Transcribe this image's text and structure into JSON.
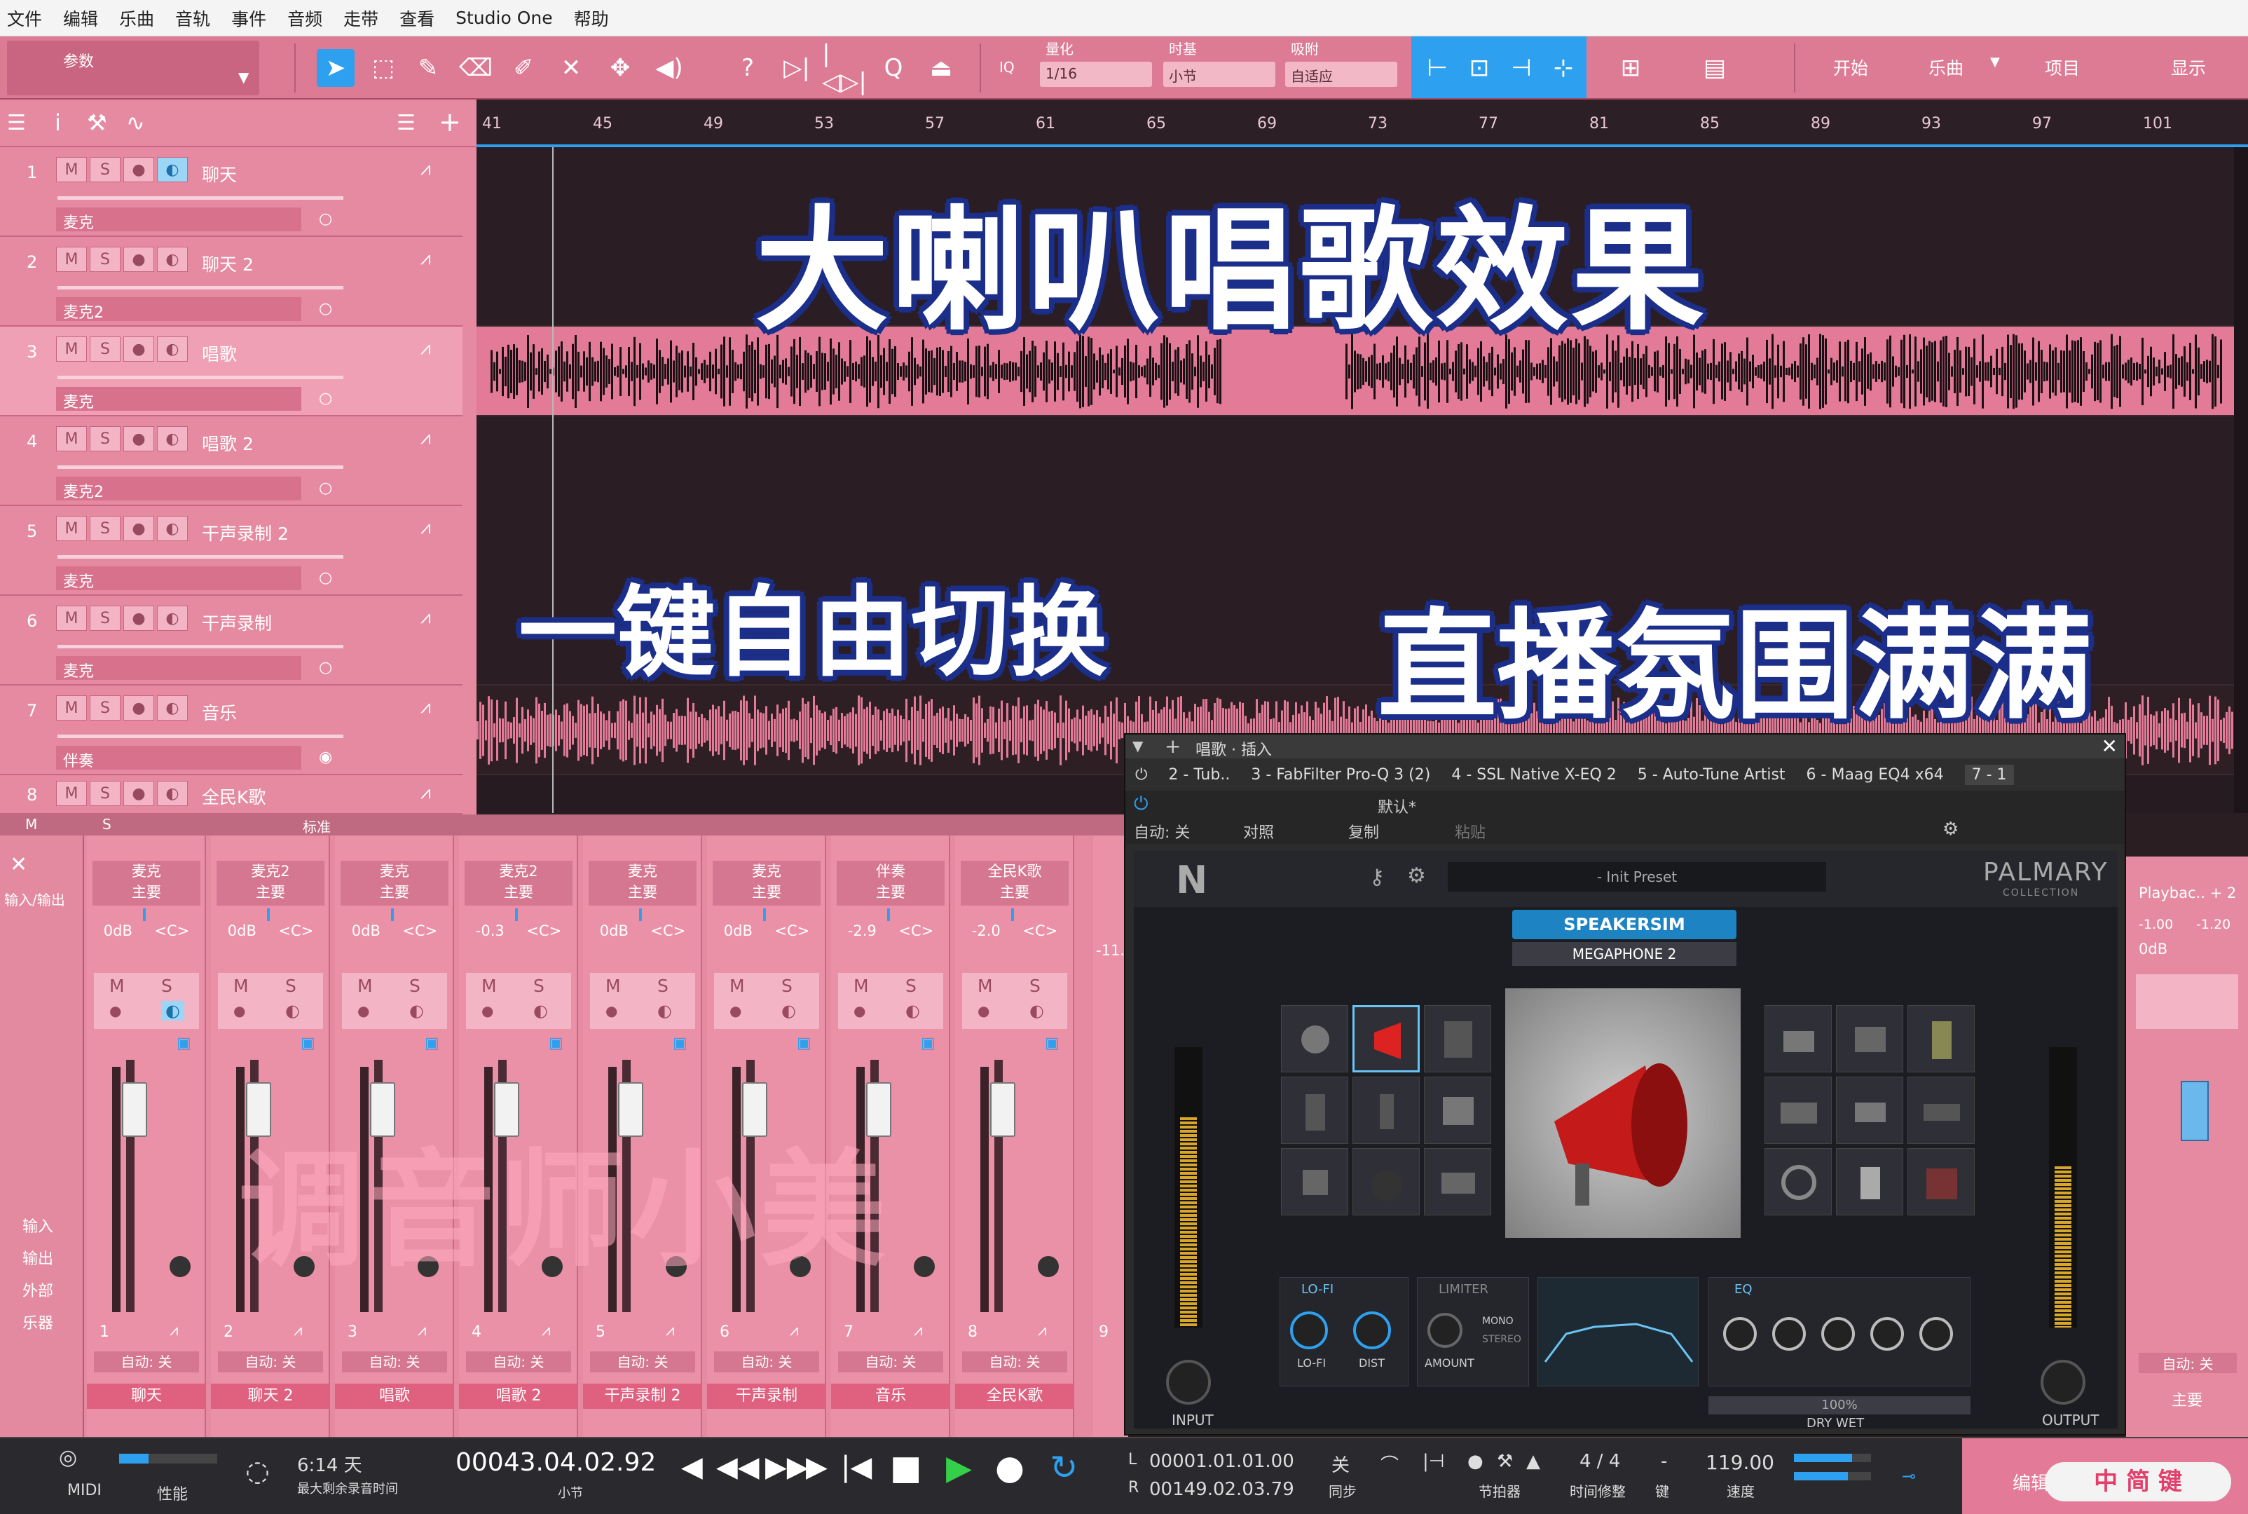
{
  "menu": [
    "文件",
    "编辑",
    "乐曲",
    "音轨",
    "事件",
    "音频",
    "走带",
    "查看",
    "Studio One",
    "帮助"
  ],
  "toolbar": {
    "params_label": "参数",
    "quantize_label": "量化",
    "quantize_value": "1/16",
    "timebase_label": "时基",
    "timebase_value": "小节",
    "snap_label": "吸附",
    "snap_value": "自适应",
    "iq_label": "IQ",
    "right_buttons": [
      "开始",
      "乐曲",
      "项目",
      "显示"
    ]
  },
  "ruler": [
    "41",
    "45",
    "49",
    "53",
    "57",
    "61",
    "65",
    "69",
    "73",
    "77",
    "81",
    "85",
    "89",
    "93",
    "97",
    "101"
  ],
  "tracks": [
    {
      "num": "1",
      "name": "聊天",
      "input": "麦克",
      "monitor": true
    },
    {
      "num": "2",
      "name": "聊天 2",
      "input": "麦克2",
      "monitor": false
    },
    {
      "num": "3",
      "name": "唱歌",
      "input": "麦克",
      "monitor": false
    },
    {
      "num": "4",
      "name": "唱歌 2",
      "input": "麦克2",
      "monitor": false
    },
    {
      "num": "5",
      "name": "干声录制 2",
      "input": "麦克",
      "monitor": false
    },
    {
      "num": "6",
      "name": "干声录制",
      "input": "麦克",
      "monitor": false
    },
    {
      "num": "7",
      "name": "音乐",
      "input": "伴奏",
      "monitor": false
    },
    {
      "num": "8",
      "name": "全民K歌",
      "input": "",
      "monitor": false
    }
  ],
  "track_buttons": {
    "m": "M",
    "s": "S"
  },
  "overlay": {
    "title": "大喇叭唱歌效果",
    "left_caption": "一键自由切换",
    "right_caption": "直播氛围满满",
    "watermark": "调音师小美"
  },
  "mixer": {
    "toolbar_label": "标准",
    "left_labels": [
      "输入",
      "输出",
      "外部",
      "乐器"
    ],
    "io_label": "输入/输出",
    "channels": [
      {
        "src": "麦克",
        "bus": "主要",
        "vol": "0dB",
        "pan": "<C>",
        "num": "1",
        "auto": "自动: 关",
        "name": "聊天",
        "monitor": true
      },
      {
        "src": "麦克2",
        "bus": "主要",
        "vol": "0dB",
        "pan": "<C>",
        "num": "2",
        "auto": "自动: 关",
        "name": "聊天 2",
        "monitor": false
      },
      {
        "src": "麦克",
        "bus": "主要",
        "vol": "0dB",
        "pan": "<C>",
        "num": "3",
        "auto": "自动: 关",
        "name": "唱歌",
        "monitor": false
      },
      {
        "src": "麦克2",
        "bus": "主要",
        "vol": "-0.3",
        "pan": "<C>",
        "num": "4",
        "auto": "自动: 关",
        "name": "唱歌 2",
        "monitor": false
      },
      {
        "src": "麦克",
        "bus": "主要",
        "vol": "0dB",
        "pan": "<C>",
        "num": "5",
        "auto": "自动: 关",
        "name": "干声录制 2",
        "monitor": false
      },
      {
        "src": "麦克",
        "bus": "主要",
        "vol": "0dB",
        "pan": "<C>",
        "num": "6",
        "auto": "自动: 关",
        "name": "干声录制",
        "monitor": false
      },
      {
        "src": "伴奏",
        "bus": "主要",
        "vol": "-2.9",
        "pan": "<C>",
        "num": "7",
        "auto": "自动: 关",
        "name": "音乐",
        "monitor": false
      },
      {
        "src": "全民K歌",
        "bus": "主要",
        "vol": "-2.0",
        "pan": "<C>",
        "num": "8",
        "auto": "自动: 关",
        "name": "全民K歌",
        "monitor": false
      }
    ],
    "partial_channel": {
      "vol": "-11.",
      "num": "9"
    },
    "ms": {
      "m": "M",
      "s": "S"
    },
    "right_strip": {
      "name": "Playbac.. + 2",
      "vals": [
        "-1.00",
        "-1.20"
      ],
      "vol": "0dB",
      "auto": "自动: 关",
      "label": "主要"
    }
  },
  "plugin": {
    "window_title": "唱歌 · 插入",
    "tabs": [
      "2 - Tub..",
      "3 - FabFilter Pro-Q 3 (2)",
      "4 - SSL Native X-EQ 2",
      "5 - Auto-Tune Artist",
      "6 - Maag EQ4 x64",
      "7 - 1"
    ],
    "auto_label": "自动: 关",
    "compare_label": "对照",
    "copy_label": "复制",
    "paste_label": "粘贴",
    "preset_default": "默认*",
    "preset_name": "- Init Preset",
    "brand": "PALMARY",
    "brand_sub": "COLLECTION",
    "logo": "N",
    "product": "SPEAKERSIM",
    "model": "MEGAPHONE 2",
    "input_label": "INPUT",
    "output_label": "OUTPUT",
    "lofi_title": "LO-FI",
    "lofi_knobs": [
      "LO-FI",
      "DIST"
    ],
    "limiter_title": "LIMITER",
    "limiter_knob": "AMOUNT",
    "limiter_modes": [
      "MONO",
      "STEREO"
    ],
    "eq_title": "EQ",
    "drywet_label": "DRY WET",
    "drywet_value": "100%"
  },
  "transport": {
    "midi": "MIDI",
    "perf": "性能",
    "record_time": "6:14 天",
    "record_time_label": "最大剩余录音时间",
    "position": "00043.04.02.92",
    "position_unit": "小节",
    "loop_l": "00001.01.01.00",
    "loop_r": "00149.02.03.79",
    "loop_l_label": "L",
    "loop_r_label": "R",
    "sync_value": "关",
    "sync_label": "同步",
    "metronome_label": "节拍器",
    "timesig_value": "4 / 4",
    "timesig_label": "时间修整",
    "key_value": "-",
    "key_label": "键",
    "tempo_value": "119.00",
    "tempo_label": "速度",
    "edit_label": "编辑",
    "ime_badge": "中 简 键"
  },
  "colors": {
    "accent": "#2ea0f0",
    "track_pink": "#e58aa1",
    "waveform_fill": "#e37b98",
    "title_stroke": "#1b2f8a"
  }
}
